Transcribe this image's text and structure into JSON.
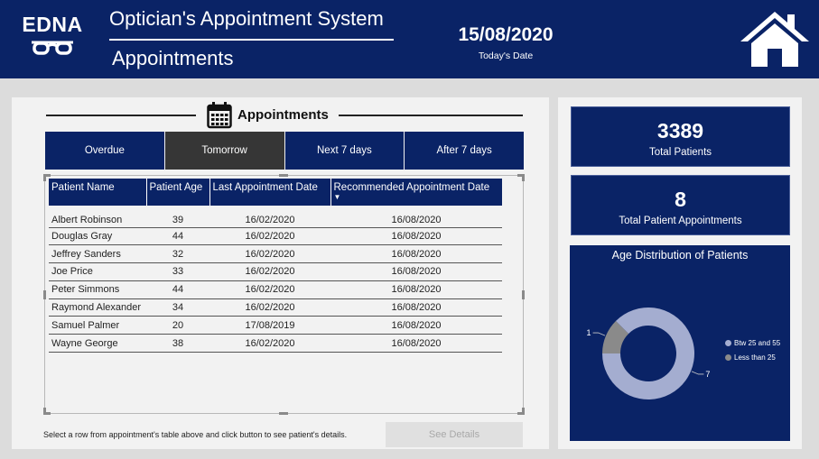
{
  "header": {
    "logo_text": "EDNA",
    "app_title": "Optician's Appointment System",
    "page_title": "Appointments",
    "date_value": "15/08/2020",
    "date_label": "Today's Date"
  },
  "appointments": {
    "section_title": "Appointments",
    "tabs": [
      {
        "label": "Overdue",
        "active": false
      },
      {
        "label": "Tomorrow",
        "active": true
      },
      {
        "label": "Next 7 days",
        "active": false
      },
      {
        "label": "After 7 days",
        "active": false
      }
    ],
    "columns": [
      "Patient Name",
      "Patient Age",
      "Last Appointment Date",
      "Recommended Appointment Date"
    ],
    "rows": [
      [
        "Albert Robinson",
        "39",
        "16/02/2020",
        "16/08/2020"
      ],
      [
        "Douglas Gray",
        "44",
        "16/02/2020",
        "16/08/2020"
      ],
      [
        "Jeffrey Sanders",
        "32",
        "16/02/2020",
        "16/08/2020"
      ],
      [
        "Joe Price",
        "33",
        "16/02/2020",
        "16/08/2020"
      ],
      [
        "Peter Simmons",
        "44",
        "16/02/2020",
        "16/08/2020"
      ],
      [
        "Raymond Alexander",
        "34",
        "16/02/2020",
        "16/08/2020"
      ],
      [
        "Samuel Palmer",
        "20",
        "17/08/2019",
        "16/08/2020"
      ],
      [
        "Wayne George",
        "38",
        "16/02/2020",
        "16/08/2020"
      ]
    ],
    "hint": "Select a row from appointment's table above and click button to see patient's details.",
    "details_button": "See Details"
  },
  "kpis": {
    "total_patients": {
      "value": "3389",
      "label": "Total Patients"
    },
    "total_appointments": {
      "value": "8",
      "label": "Total Patient Appointments"
    }
  },
  "age_chart": {
    "title": "Age Distribution of Patients",
    "slices": [
      {
        "label": "Btw 25 and 55",
        "value": 7,
        "display": "7",
        "color": "#a4add0"
      },
      {
        "label": "Less than 25",
        "value": 1,
        "display": "1",
        "color": "#8a8a8a"
      }
    ]
  },
  "colors": {
    "navy": "#0a2366",
    "active_tab": "#363636",
    "panel": "#f2f2f2"
  }
}
